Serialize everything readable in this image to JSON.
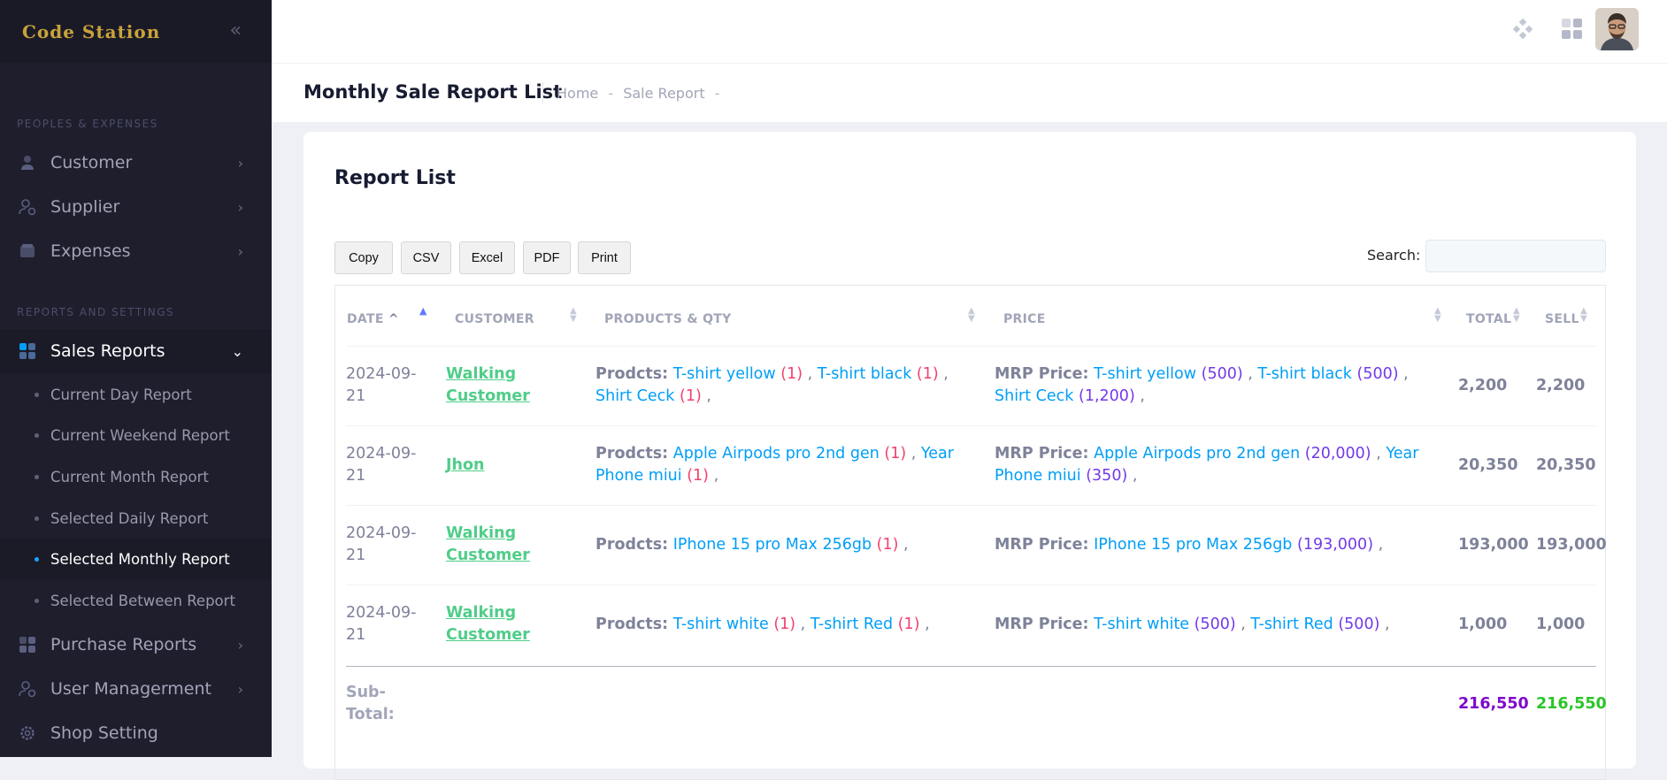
{
  "sidebar": {
    "brand": "Code Station",
    "section_1": "PEOPLES & EXPENSES",
    "section_2": "REPORTS AND SETTINGS",
    "items": [
      {
        "label": "Customer"
      },
      {
        "label": "Supplier"
      },
      {
        "label": "Expenses"
      },
      {
        "label": "Sales Reports"
      },
      {
        "label": "Purchase Reports"
      },
      {
        "label": "User Managerment"
      },
      {
        "label": "Shop Setting"
      }
    ],
    "sales_sub": [
      {
        "label": "Current Day Report"
      },
      {
        "label": "Current Weekend Report"
      },
      {
        "label": "Current Month Report"
      },
      {
        "label": "Selected Daily Report"
      },
      {
        "label": "Selected Monthly Report"
      },
      {
        "label": "Selected Between Report"
      }
    ]
  },
  "toolbar": {
    "title": "Monthly Sale Report List",
    "breadcrumb": [
      "Home",
      "-",
      "Sale Report",
      "-"
    ]
  },
  "card": {
    "title": "Report List",
    "buttons": [
      "Copy",
      "CSV",
      "Excel",
      "PDF",
      "Print"
    ],
    "search_label": "Search:",
    "search_value": ""
  },
  "table": {
    "headers": [
      "DATE",
      "CUSTOMER",
      "PRODUCTS & QTY",
      "PRICE",
      "TOTAL",
      "SELL"
    ],
    "products_prefix": "Prodcts:",
    "price_prefix": "MRP Price:",
    "rows": [
      {
        "date_1": "2024-09-",
        "date_2": "21",
        "customer_1": "Walking",
        "customer_2": "Customer",
        "products": [
          [
            "T-shirt yellow",
            "(1)"
          ],
          [
            "T-shirt black",
            "(1)"
          ],
          [
            "Shirt Ceck",
            "(1)"
          ]
        ],
        "prices": [
          [
            "T-shirt yellow",
            "(500)"
          ],
          [
            "T-shirt black",
            "(500)"
          ],
          [
            "Shirt Ceck",
            "(1,200)"
          ]
        ],
        "total": "2,200",
        "sell": "2,200"
      },
      {
        "date_1": "2024-09-",
        "date_2": "21",
        "customer_1": "Jhon",
        "customer_2": "",
        "products": [
          [
            "Apple Airpods pro 2nd gen",
            "(1)"
          ],
          [
            "Year Phone miui",
            "(1)"
          ]
        ],
        "prices": [
          [
            "Apple Airpods pro 2nd gen",
            "(20,000)"
          ],
          [
            "Year Phone miui",
            "(350)"
          ]
        ],
        "total": "20,350",
        "sell": "20,350"
      },
      {
        "date_1": "2024-09-",
        "date_2": "21",
        "customer_1": "Walking",
        "customer_2": "Customer",
        "products": [
          [
            "IPhone 15 pro Max 256gb",
            "(1)"
          ]
        ],
        "prices": [
          [
            "IPhone 15 pro Max 256gb",
            "(193,000)"
          ]
        ],
        "total": "193,000",
        "sell": "193,000"
      },
      {
        "date_1": "2024-09-",
        "date_2": "21",
        "customer_1": "Walking",
        "customer_2": "Customer",
        "products": [
          [
            "T-shirt white",
            "(1)"
          ],
          [
            "T-shirt Red",
            "(1)"
          ]
        ],
        "prices": [
          [
            "T-shirt white",
            "(500)"
          ],
          [
            "T-shirt Red",
            "(500)"
          ]
        ],
        "total": "1,000",
        "sell": "1,000"
      }
    ],
    "subtotal_label_1": "Sub-",
    "subtotal_label_2": "Total:",
    "subtotal_total": "216,550",
    "subtotal_sell": "216,550"
  },
  "colors": {
    "sidebar_bg": "#1e1e2d",
    "link_green": "#50cd89",
    "product_blue": "#009ef7",
    "qty_red": "#f1416c",
    "price_purple": "#7239ea",
    "subtotal_total": "#7e0acb",
    "subtotal_sell": "#2bc52a"
  }
}
